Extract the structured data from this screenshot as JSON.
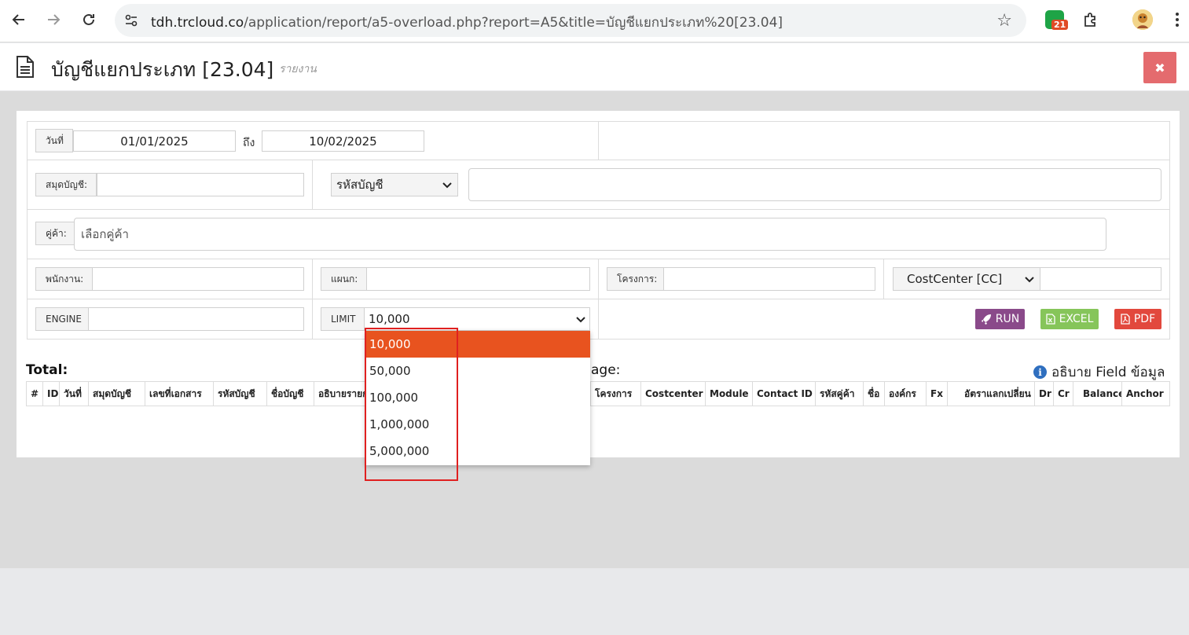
{
  "browser": {
    "url_host": "tdh.trcloud.co",
    "url_path": "/application/report/a5-overload.php?report=A5&title=บัญชีแยกประเภท%20[23.04]",
    "extension_badge": "21"
  },
  "header": {
    "title": "บัญชีแยกประเภท [23.04]",
    "subtitle": "รายงาน"
  },
  "form": {
    "date_label": "วันที่",
    "date_from": "01/01/2025",
    "to_label": "ถึง",
    "date_to": "10/02/2025",
    "book_label": "สมุดบัญชี:",
    "account_code_select": "รหัสบัญชี",
    "partner_label": "คู่ค้า:",
    "partner_placeholder": "เลือกคู่ค้า",
    "employee_label": "พนักงาน:",
    "dept_label": "แผนก:",
    "project_label": "โครงการ:",
    "costcenter_select": "CostCenter [CC]",
    "engine_label": "ENGINE",
    "limit_label": "LIMIT",
    "limit_value": "10,000"
  },
  "buttons": {
    "run": "RUN",
    "excel": "EXCEL",
    "pdf": "PDF"
  },
  "summary": {
    "total_label": "Total:",
    "page_label": "age:",
    "explain_label": "อธิบาย Field ข้อมูล"
  },
  "table": {
    "columns": [
      "#",
      "ID",
      "วันที่",
      "สมุดบัญชี",
      "เลขที่เอกสาร",
      "รหัสบัญชี",
      "ชื่อบัญชี",
      "อธิบายรายก",
      "โครงการ",
      "Costcenter",
      "Module",
      "Contact ID",
      "รหัสคู่ค้า",
      "ชื่อ",
      "องค์กร",
      "Fx",
      "อัตราแลกเปลี่ยน",
      "Dr",
      "Cr",
      "Balance",
      "Anchor"
    ]
  },
  "limit_dropdown": {
    "options": [
      "10,000",
      "50,000",
      "100,000",
      "1,000,000",
      "5,000,000"
    ],
    "selected": "10,000"
  },
  "colors": {
    "accent_selected": "#e8531f",
    "run": "#8a4a8a",
    "excel": "#86c55a",
    "pdf": "#e2483d",
    "close": "#e46b6e",
    "highlight_box": "#e02020"
  }
}
